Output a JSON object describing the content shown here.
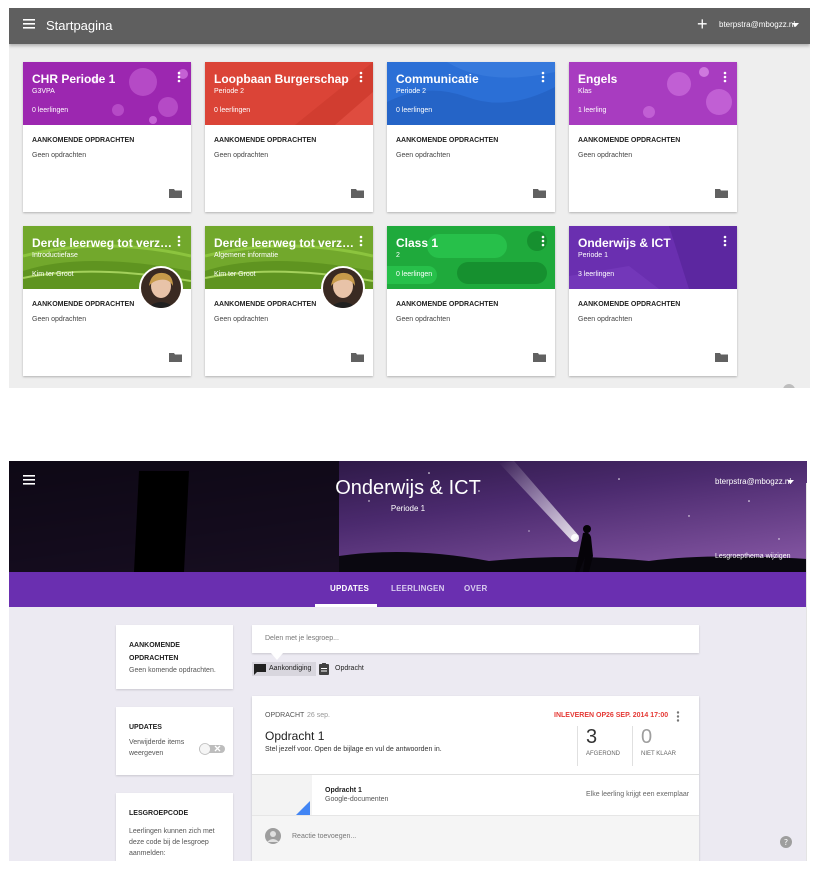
{
  "top_screen": {
    "app_title": "Startpagina",
    "account": "bterpstra@mbogzz.nl",
    "classes": [
      {
        "title": "CHR Periode 1",
        "subtitle": "G3VPA",
        "students": "0 leerlingen",
        "upcoming_label": "AANKOMENDE OPDRACHTEN",
        "upcoming_value": "Geen opdrachten",
        "color": "#9c27b0"
      },
      {
        "title": "Loopbaan Burgerschap",
        "subtitle": "Periode 2",
        "students": "0 leerlingen",
        "upcoming_label": "AANKOMENDE OPDRACHTEN",
        "upcoming_value": "Geen opdrachten",
        "color": "#db4437"
      },
      {
        "title": "Communicatie",
        "subtitle": "Periode 2",
        "students": "0 leerlingen",
        "upcoming_label": "AANKOMENDE OPDRACHTEN",
        "upcoming_value": "Geen opdrachten",
        "color": "#2b6fd6"
      },
      {
        "title": "Engels",
        "subtitle": "Klas",
        "students": "1 leerling",
        "upcoming_label": "AANKOMENDE OPDRACHTEN",
        "upcoming_value": "Geen opdrachten",
        "color": "#a83cc0"
      },
      {
        "title": "Derde leerweg tot verzorg...",
        "subtitle": "Introductiefase",
        "students": "Kim ter Groot",
        "upcoming_label": "AANKOMENDE OPDRACHTEN",
        "upcoming_value": "Geen opdrachten",
        "color": "#72a82c"
      },
      {
        "title": "Derde leerweg tot verzorg...",
        "subtitle": "Algemene informatie",
        "students": "Kim ter Groot",
        "upcoming_label": "AANKOMENDE OPDRACHTEN",
        "upcoming_value": "Geen opdrachten",
        "color": "#72a82c"
      },
      {
        "title": "Class 1",
        "subtitle": "2",
        "students": "0 leerlingen",
        "upcoming_label": "AANKOMENDE OPDRACHTEN",
        "upcoming_value": "Geen opdrachten",
        "color": "#1faa3c"
      },
      {
        "title": "Onderwijs & ICT",
        "subtitle": "Periode 1",
        "students": "3 leerlingen",
        "upcoming_label": "AANKOMENDE OPDRACHTEN",
        "upcoming_value": "Geen opdrachten",
        "color": "#6a2fb0"
      }
    ]
  },
  "bottom_screen": {
    "class_title": "Onderwijs & ICT",
    "class_subtitle": "Periode 1",
    "account": "bterpstra@mbogzz.nl",
    "change_theme": "Lesgroepthema wijzigen",
    "tabs": [
      "UPDATES",
      "LEERLINGEN",
      "OVER"
    ],
    "active_tab": "UPDATES",
    "sidebar": {
      "upcoming_title_line1": "AANKOMENDE",
      "upcoming_title_line2": "OPDRACHTEN",
      "upcoming_text": "Geen komende opdrachten.",
      "updates_title": "UPDATES",
      "updates_toggle_line1": "Verwijderde items",
      "updates_toggle_line2": "weergeven",
      "code_title": "LESGROEPCODE",
      "code_text_line1": "Leerlingen kunnen zich met",
      "code_text_line2": "deze code bij de lesgroep",
      "code_text_line3": "aanmelden:"
    },
    "share_placeholder": "Delen met je lesgroep...",
    "compose_options": {
      "announcement": "Aankondiging",
      "assignment": "Opdracht"
    },
    "post": {
      "type": "OPDRACHT",
      "date": "26 sep.",
      "due_label": "INLEVEREN OP",
      "due_date": "26 SEP. 2014 17:00",
      "title": "Opdracht 1",
      "description": "Stel jezelf voor. Open de bijlage en vul de antwoorden in.",
      "done_count": "3",
      "done_label": "AFGEROND",
      "notdone_count": "0",
      "notdone_label": "NIET KLAAR",
      "attachment_title": "Opdracht 1",
      "attachment_type": "Google-documenten",
      "attachment_note": "Elke leerling krijgt een exemplaar",
      "comment_placeholder": "Reactie toevoegen..."
    },
    "help_icon": "help-icon"
  }
}
